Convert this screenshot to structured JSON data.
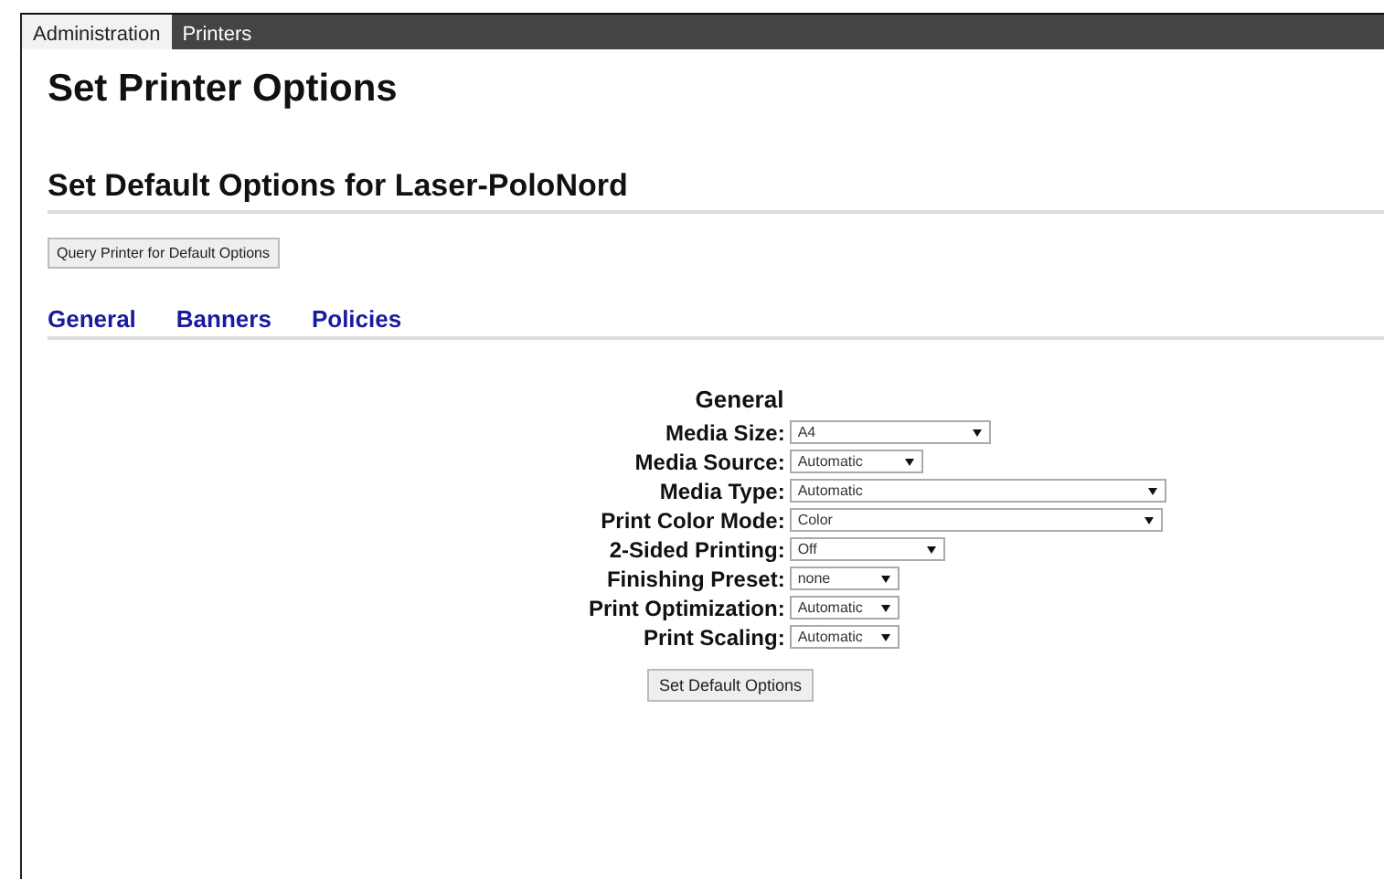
{
  "tabs": [
    {
      "label": "Administration",
      "selected": true
    },
    {
      "label": "Printers",
      "selected": false
    }
  ],
  "page_title": "Set Printer Options",
  "section_title": "Set Default Options for Laser-PoloNord",
  "query_button": "Query Printer for Default Options",
  "option_tabs": [
    "General",
    "Banners",
    "Policies"
  ],
  "group_title": "General",
  "options": [
    {
      "label": "Media Size:",
      "value": "A4"
    },
    {
      "label": "Media Source:",
      "value": "Automatic"
    },
    {
      "label": "Media Type:",
      "value": "Automatic"
    },
    {
      "label": "Print Color Mode:",
      "value": "Color"
    },
    {
      "label": "2-Sided Printing:",
      "value": "Off"
    },
    {
      "label": "Finishing Preset:",
      "value": "none"
    },
    {
      "label": "Print Optimization:",
      "value": "Automatic"
    },
    {
      "label": "Print Scaling:",
      "value": "Automatic"
    }
  ],
  "submit_button": "Set Default Options"
}
